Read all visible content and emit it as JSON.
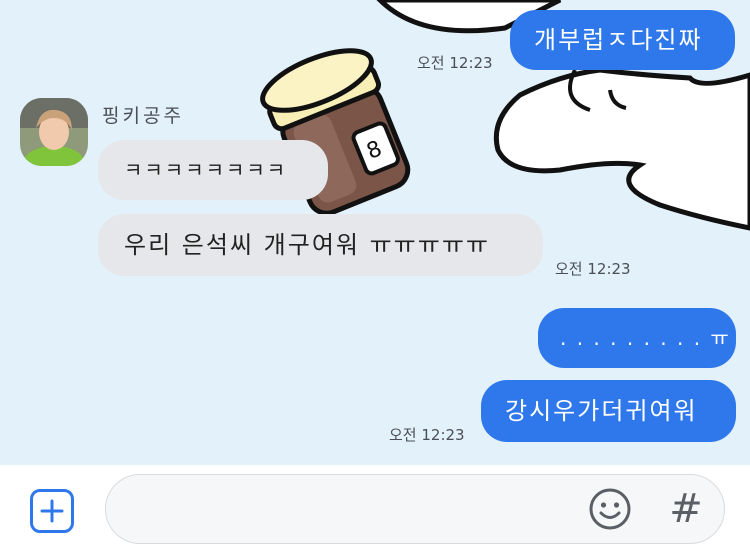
{
  "messages": [
    {
      "text": "개부럽ㅈ다진짜",
      "time": "오전 12:23"
    },
    {
      "sender": "핑키공주",
      "text": "ㅋㅋㅋㅋㅋㅋㅋㅋ"
    },
    {
      "text": "우리 은석씨 개구여워 ㅠㅠㅠㅠㅠ",
      "time": "오전 12:23"
    },
    {
      "text": ". . . . . . . . . ㅠ"
    },
    {
      "text": "강시우가더귀여워",
      "time": "오전 12:23"
    }
  ],
  "input": {
    "placeholder": "",
    "hash_label": "#"
  },
  "icons": {
    "add": "plus-icon",
    "emoji": "smiley-icon"
  },
  "colors": {
    "chat_background": "#e3f1fa",
    "outgoing_bubble": "#2f78ec",
    "incoming_bubble": "#e6e7ea"
  }
}
